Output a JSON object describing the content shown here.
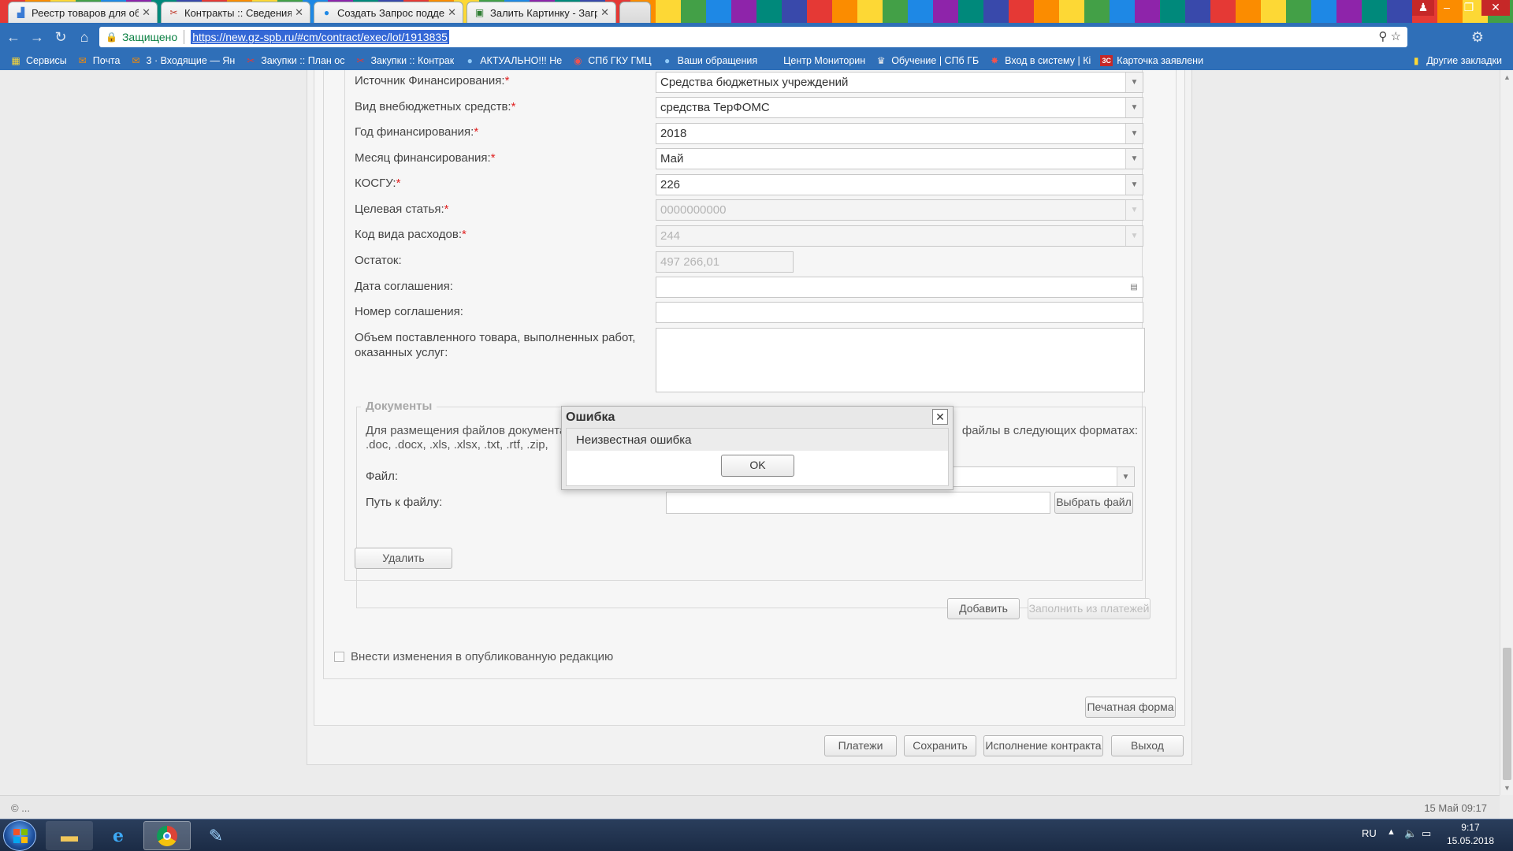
{
  "tabs": [
    {
      "title": "Реестр товаров для обе",
      "icon": "chart-icon"
    },
    {
      "title": "Контракты :: Сведения о",
      "icon": "tools-icon"
    },
    {
      "title": "Создать Запрос подде",
      "icon": "help-globe-icon"
    },
    {
      "title": "Залить Картинку - Загр",
      "icon": "image-icon"
    }
  ],
  "address": {
    "security_label": "Защищено",
    "url": "https://new.gz-spb.ru/#cm/contract/exec/lot/1913835"
  },
  "bookmarks": [
    {
      "label": "Сервисы"
    },
    {
      "label": "Почта"
    },
    {
      "label": "3 · Входящие — Ян"
    },
    {
      "label": "Закупки :: План ос"
    },
    {
      "label": "Закупки :: Контрак"
    },
    {
      "label": "АКТУАЛЬНО!!! Не"
    },
    {
      "label": "СПб ГКУ ГМЦ"
    },
    {
      "label": "Ваши обращения"
    },
    {
      "label": "Центр Мониторин"
    },
    {
      "label": "Обучение | СПб ГБ"
    },
    {
      "label": "Вход в систему | Кі"
    },
    {
      "label": "Карточка заявлени"
    }
  ],
  "bookmarks_other": "Другие закладки",
  "form": {
    "financing_source": {
      "label": "Источник Финансирования:",
      "value": "Средства бюджетных учреждений"
    },
    "extrabudget_type": {
      "label": "Вид внебюджетных средств:",
      "value": "средства ТерФОМС"
    },
    "financing_year": {
      "label": "Год финансирования:",
      "value": "2018"
    },
    "financing_month": {
      "label": "Месяц финансирования:",
      "value": "Май"
    },
    "kosgu": {
      "label": "КОСГУ:",
      "value": "226"
    },
    "target_article": {
      "label": "Целевая статья:",
      "value": "0000000000"
    },
    "expense_code": {
      "label": "Код вида расходов:",
      "value": "244"
    },
    "balance": {
      "label": "Остаток:",
      "value": "497 266,01"
    },
    "agreement_date": {
      "label": "Дата соглашения:",
      "value": ""
    },
    "agreement_number": {
      "label": "Номер соглашения:",
      "value": ""
    },
    "volume_line1": "Объем поставленного товара, выполненных работ,",
    "volume_line2": "оказанных услуг:",
    "required_mark": "*"
  },
  "documents": {
    "legend": "Документы",
    "info_line1_left": "Для размещения файлов документа",
    "info_line1_right": "файлы в следующих форматах:",
    "info_line2": ".doc, .docx, .xls, .xlsx, .txt, .rtf, .zip,",
    "file_label": "Файл:",
    "path_label": "Путь к файлу:",
    "choose_file": "Выбрать файл"
  },
  "buttons": {
    "delete": "Удалить",
    "add": "Добавить",
    "fill_from_payments": "Заполнить из платежей",
    "print_form": "Печатная форма",
    "payments": "Платежи",
    "save": "Сохранить",
    "contract_execution": "Исполнение контракта",
    "exit": "Выход"
  },
  "checkbox_label": "Внести изменения в опубликованную редакцию",
  "dialog": {
    "title": "Ошибка",
    "message": "Неизвестная ошибка",
    "ok": "OK"
  },
  "status": {
    "copyright": "© ...",
    "datetime": "15 Май 09:17"
  },
  "taskbar": {
    "lang": "RU",
    "time": "9:17",
    "date": "15.05.2018"
  },
  "colors": {
    "required": "#e02020",
    "chrome_blue": "#2f6fb8",
    "url_highlight": "#3367d6"
  }
}
